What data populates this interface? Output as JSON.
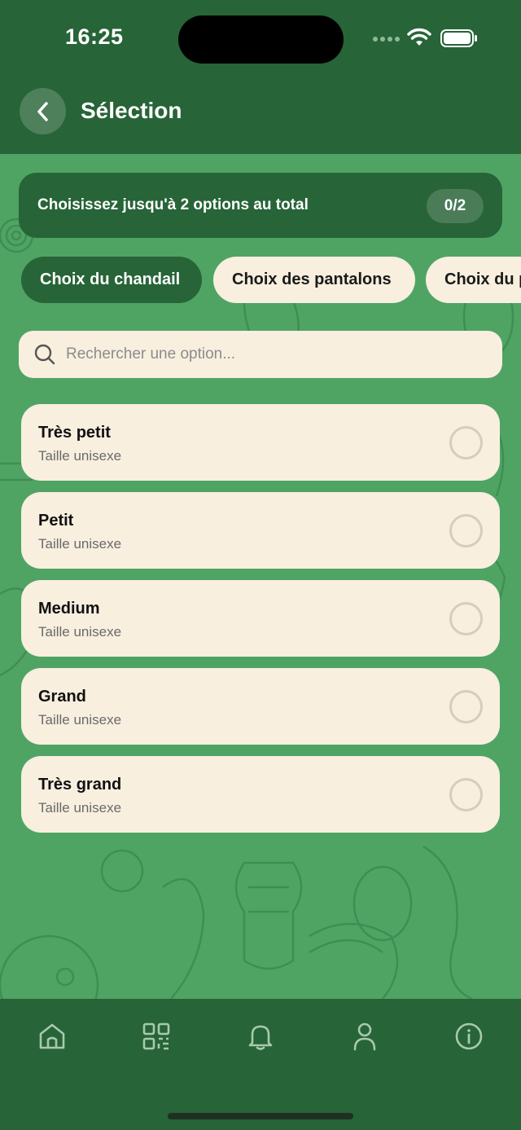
{
  "status_bar": {
    "time": "16:25"
  },
  "header": {
    "title": "Sélection"
  },
  "limit": {
    "text": "Choisissez jusqu'à 2 options au total",
    "counter": "0/2"
  },
  "tabs": [
    {
      "label": "Choix du chandail",
      "active": true
    },
    {
      "label": "Choix des pantalons",
      "active": false
    },
    {
      "label": "Choix du pantalon",
      "active": false
    }
  ],
  "search": {
    "placeholder": "Rechercher une option..."
  },
  "options": [
    {
      "title": "Très petit",
      "subtitle": "Taille unisexe",
      "selected": false
    },
    {
      "title": "Petit",
      "subtitle": "Taille unisexe",
      "selected": false
    },
    {
      "title": "Medium",
      "subtitle": "Taille unisexe",
      "selected": false
    },
    {
      "title": "Grand",
      "subtitle": "Taille unisexe",
      "selected": false
    },
    {
      "title": "Très grand",
      "subtitle": "Taille unisexe",
      "selected": false
    }
  ],
  "bottom_nav": [
    {
      "icon": "home-icon"
    },
    {
      "icon": "qr-code-icon"
    },
    {
      "icon": "bell-icon"
    },
    {
      "icon": "profile-icon"
    },
    {
      "icon": "info-icon"
    }
  ],
  "colors": {
    "header": "#276437",
    "background": "#4fa464",
    "card": "#f8efdf",
    "active_tab": "#276437"
  }
}
